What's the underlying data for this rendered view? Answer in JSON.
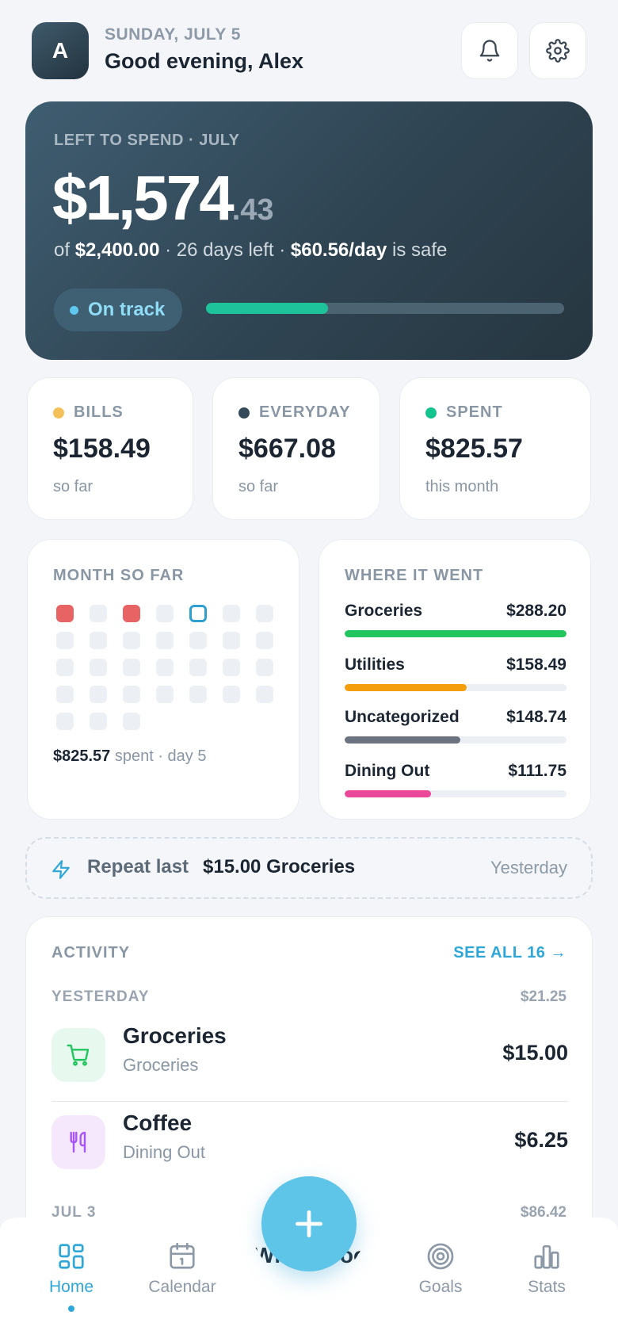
{
  "header": {
    "avatar_initial": "A",
    "date": "SUNDAY, JULY 5",
    "greeting": "Good evening, Alex",
    "icons": [
      "bell-icon",
      "gear-icon"
    ]
  },
  "hero": {
    "label": "LEFT TO SPEND · JULY",
    "amount_main": "$1,574",
    "amount_cents": ".43",
    "sub_of": "of",
    "budget": "$2,400.00",
    "days_left": "· 26 days left ·",
    "daily": "$60.56/day",
    "safe_text": "is safe",
    "status": "On track",
    "progress_fraction": 0.34,
    "accent_color": "#1fc39b"
  },
  "stats": [
    {
      "label": "BILLS",
      "value": "$158.49",
      "sub": "so far",
      "color": "#f4c05a"
    },
    {
      "label": "EVERYDAY",
      "value": "$667.08",
      "sub": "so far",
      "color": "#34495a"
    },
    {
      "label": "SPENT",
      "value": "$825.57",
      "sub": "this month",
      "color": "#14c38e"
    }
  ],
  "month": {
    "title": "MONTH SO FAR",
    "spent": "$825.57",
    "spent_suffix": "spent · day 5",
    "days_with_spend": [
      1,
      3
    ],
    "today": 5,
    "days_in_month": 31
  },
  "where": {
    "title": "WHERE IT WENT",
    "categories": [
      {
        "name": "Groceries",
        "amount": "$288.20",
        "fraction": 1.0,
        "color": "#23c55e"
      },
      {
        "name": "Utilities",
        "amount": "$158.49",
        "fraction": 0.55,
        "color": "#f59e0b"
      },
      {
        "name": "Uncategorized",
        "amount": "$148.74",
        "fraction": 0.52,
        "color": "#6b7280"
      },
      {
        "name": "Dining Out",
        "amount": "$111.75",
        "fraction": 0.39,
        "color": "#ec4899"
      }
    ]
  },
  "repeat": {
    "label": "Repeat last",
    "item": "$15.00 Groceries",
    "when": "Yesterday"
  },
  "activity": {
    "title": "ACTIVITY",
    "see_all": "SEE ALL 16 →",
    "groups": [
      {
        "day": "YESTERDAY",
        "total": "$21.25",
        "items": [
          {
            "name": "Groceries",
            "category": "Groceries",
            "amount": "$15.00",
            "icon": "cart-icon",
            "bg": "#e7f8ef",
            "fg": "#22c55e"
          },
          {
            "name": "Coffee",
            "category": "Dining Out",
            "amount": "$6.25",
            "icon": "utensils-icon",
            "bg": "#f5e8fd",
            "fg": "#a855f7"
          }
        ]
      },
      {
        "day": "JUL 3",
        "total": "$86.42",
        "items": [
          {
            "name": "Whole Foods",
            "category": "",
            "amount": "",
            "icon": "",
            "bg": "",
            "fg": ""
          }
        ]
      }
    ]
  },
  "nav": {
    "items": [
      {
        "label": "Home",
        "icon": "home-grid-icon",
        "active": true
      },
      {
        "label": "Calendar",
        "icon": "calendar-icon",
        "active": false
      },
      {
        "label": "Goals",
        "icon": "target-icon",
        "active": false
      },
      {
        "label": "Stats",
        "icon": "bar-chart-icon",
        "active": false
      }
    ],
    "add_icon": "plus-icon"
  }
}
